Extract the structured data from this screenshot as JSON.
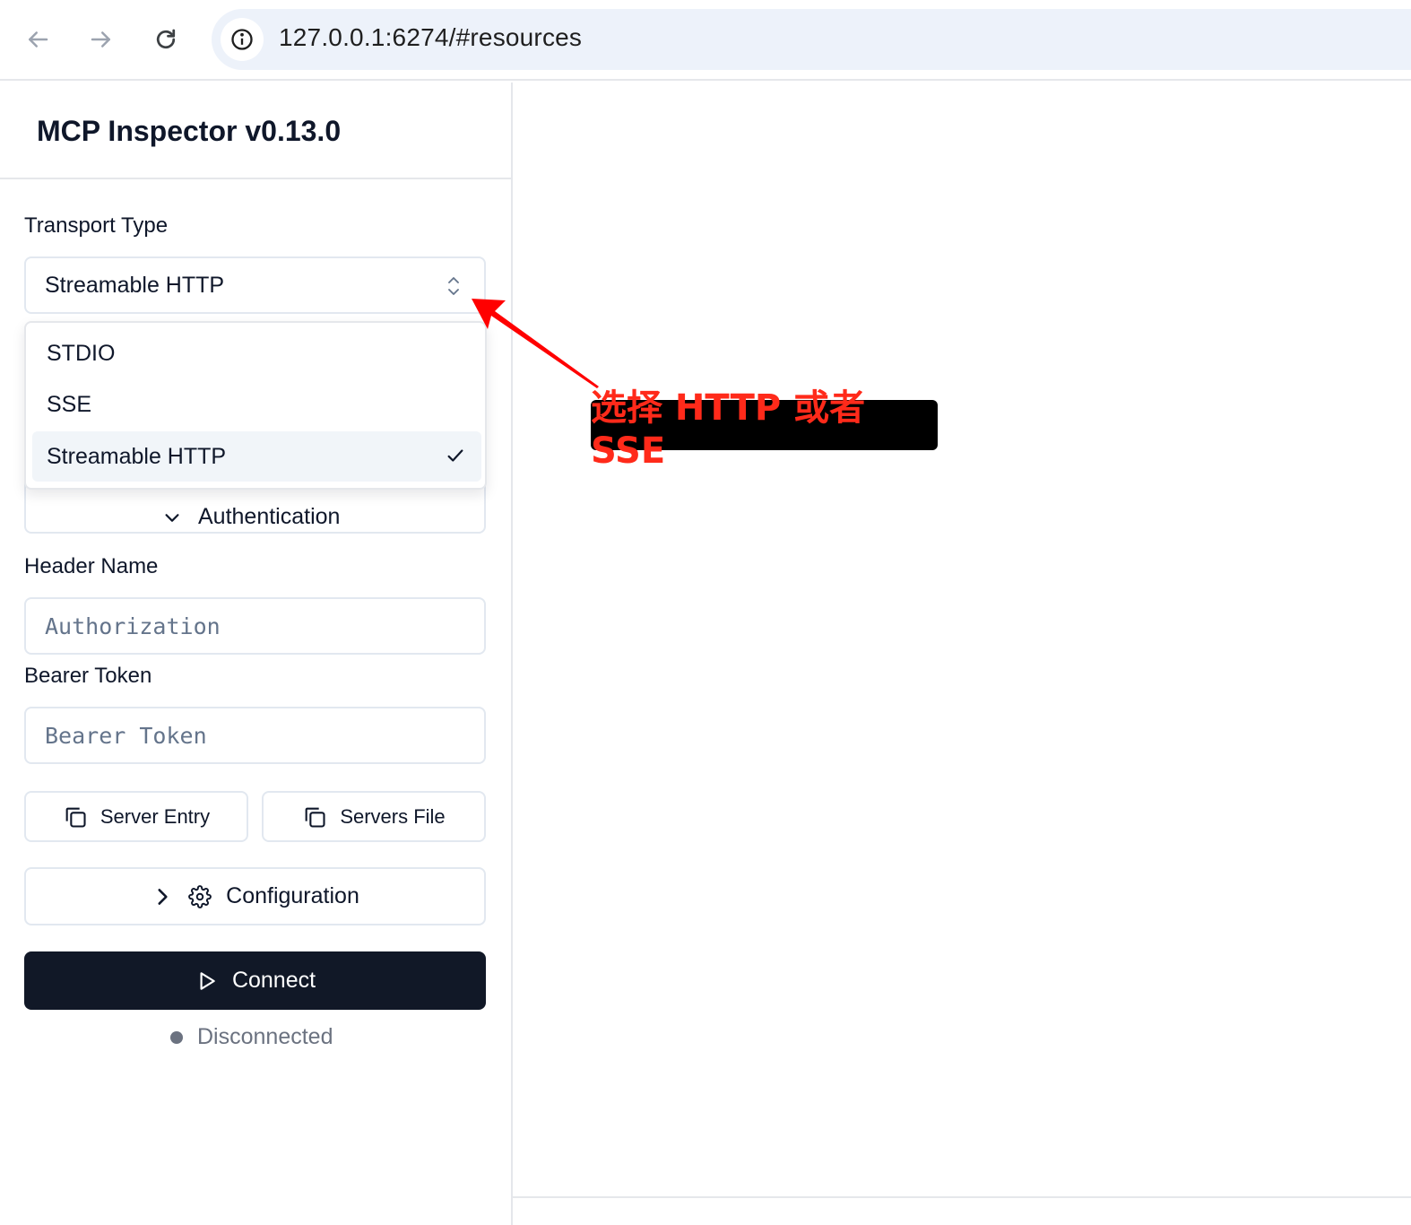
{
  "browser": {
    "url": "127.0.0.1:6274/#resources"
  },
  "sidebar": {
    "title": "MCP Inspector v0.13.0",
    "transport": {
      "label": "Transport Type",
      "selected": "Streamable HTTP",
      "options": [
        "STDIO",
        "SSE",
        "Streamable HTTP"
      ]
    },
    "auth": {
      "toggle_label": "Authentication",
      "header_name_label": "Header Name",
      "header_name_placeholder": "Authorization",
      "bearer_token_label": "Bearer Token",
      "bearer_token_placeholder": "Bearer Token"
    },
    "buttons": {
      "server_entry": "Server Entry",
      "servers_file": "Servers File",
      "configuration": "Configuration",
      "connect": "Connect"
    },
    "status": {
      "text": "Disconnected",
      "color": "#6b7280"
    }
  },
  "annotation": {
    "text": "选择 HTTP 或者 SSE",
    "text_color": "#ff2a1a",
    "background": "#000000",
    "arrow_color": "#ff0000"
  },
  "icons": {
    "back": "arrow-left-icon",
    "forward": "arrow-right-icon",
    "reload": "reload-icon",
    "site_info": "info-icon",
    "select_chevrons": "chevrons-up-down-icon",
    "check": "check-icon",
    "auth_chevron": "chevron-down-icon",
    "copy": "copy-icon",
    "config_chevron": "chevron-right-icon",
    "settings": "gear-icon",
    "play": "play-icon"
  }
}
